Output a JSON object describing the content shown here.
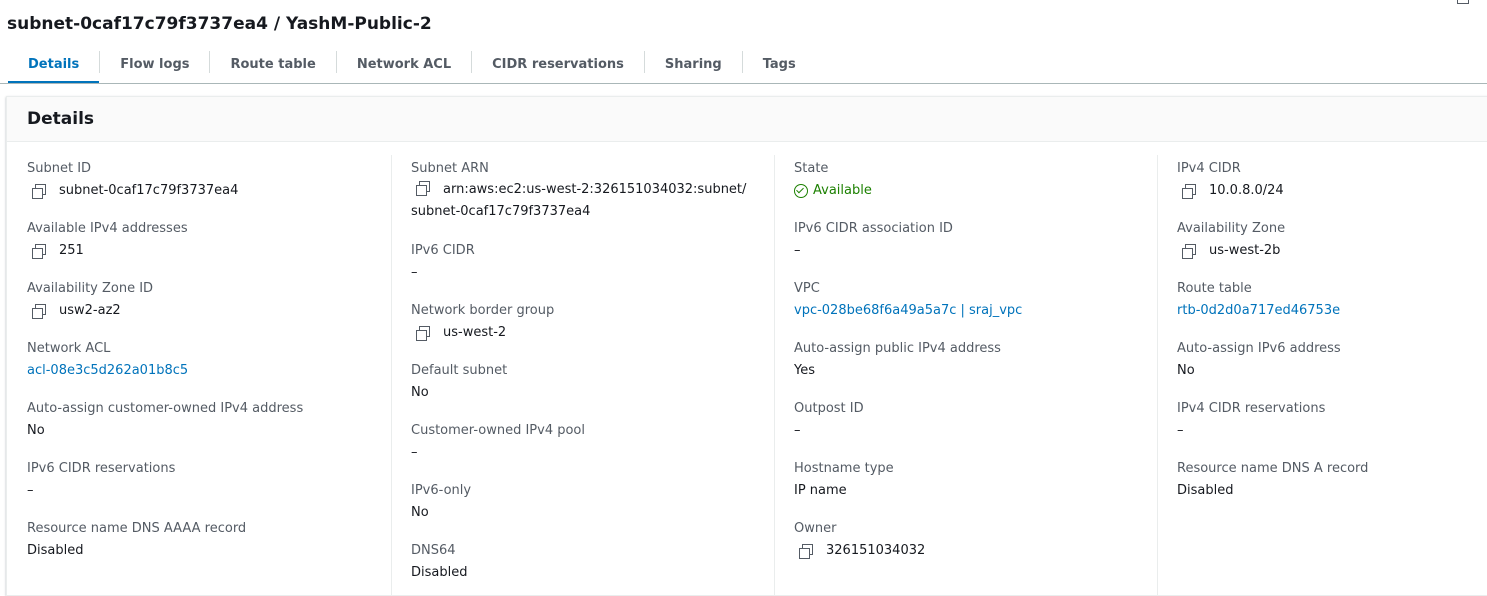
{
  "page": {
    "title": "subnet-0caf17c79f3737ea4 / YashM-Public-2"
  },
  "tabs": [
    {
      "label": "Details",
      "active": true
    },
    {
      "label": "Flow logs"
    },
    {
      "label": "Route table"
    },
    {
      "label": "Network ACL"
    },
    {
      "label": "CIDR reservations"
    },
    {
      "label": "Sharing"
    },
    {
      "label": "Tags"
    }
  ],
  "panel": {
    "title": "Details"
  },
  "col1": {
    "subnet_id_label": "Subnet ID",
    "subnet_id_value": "subnet-0caf17c79f3737ea4",
    "available_ipv4_label": "Available IPv4 addresses",
    "available_ipv4_value": "251",
    "az_id_label": "Availability Zone ID",
    "az_id_value": "usw2-az2",
    "network_acl_label": "Network ACL",
    "network_acl_value": "acl-08e3c5d262a01b8c5",
    "auto_assign_coip_label": "Auto-assign customer-owned IPv4 address",
    "auto_assign_coip_value": "No",
    "ipv6_cidr_res_label": "IPv6 CIDR reservations",
    "ipv6_cidr_res_value": "–",
    "dns_aaaa_label": "Resource name DNS AAAA record",
    "dns_aaaa_value": "Disabled"
  },
  "col2": {
    "subnet_arn_label": "Subnet ARN",
    "subnet_arn_line1": "arn:aws:ec2:us-west-2:326151034032:subnet/",
    "subnet_arn_line2": "subnet-0caf17c79f3737ea4",
    "ipv6_cidr_label": "IPv6 CIDR",
    "ipv6_cidr_value": "–",
    "nbg_label": "Network border group",
    "nbg_value": "us-west-2",
    "default_subnet_label": "Default subnet",
    "default_subnet_value": "No",
    "coip_pool_label": "Customer-owned IPv4 pool",
    "coip_pool_value": "–",
    "ipv6_only_label": "IPv6-only",
    "ipv6_only_value": "No",
    "dns64_label": "DNS64",
    "dns64_value": "Disabled"
  },
  "col3": {
    "state_label": "State",
    "state_value": "Available",
    "ipv6_assoc_label": "IPv6 CIDR association ID",
    "ipv6_assoc_value": "–",
    "vpc_label": "VPC",
    "vpc_value": "vpc-028be68f6a49a5a7c | sraj_vpc",
    "auto_public_label": "Auto-assign public IPv4 address",
    "auto_public_value": "Yes",
    "outpost_label": "Outpost ID",
    "outpost_value": "–",
    "hostname_label": "Hostname type",
    "hostname_value": "IP name",
    "owner_label": "Owner",
    "owner_value": "326151034032"
  },
  "col4": {
    "ipv4_cidr_label": "IPv4 CIDR",
    "ipv4_cidr_value": "10.0.8.0/24",
    "az_label": "Availability Zone",
    "az_value": "us-west-2b",
    "route_table_label": "Route table",
    "route_table_value": "rtb-0d2d0a717ed46753e",
    "auto_ipv6_label": "Auto-assign IPv6 address",
    "auto_ipv6_value": "No",
    "ipv4_cidr_res_label": "IPv4 CIDR reservations",
    "ipv4_cidr_res_value": "–",
    "dns_a_label": "Resource name DNS A record",
    "dns_a_value": "Disabled"
  }
}
